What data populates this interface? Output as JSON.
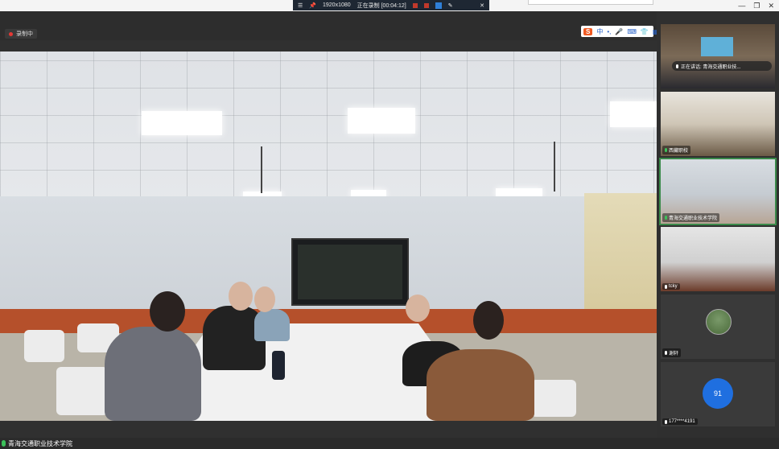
{
  "recorder_toolbar": {
    "resolution": "1920x1080",
    "status": "正在录制 [00:04:12]"
  },
  "stage": {
    "recording_badge": "录制中",
    "main_participant_label": "青海交通职业技术学院"
  },
  "ime": {
    "logo": "S",
    "lang": "中"
  },
  "participants": [
    {
      "name": "",
      "speaking_text": "正在讲话: 青海交通职业技..."
    },
    {
      "name": "西藏职校"
    },
    {
      "name": "青海交通职业技术学院"
    },
    {
      "name": "tcky"
    },
    {
      "name": "谢轩"
    },
    {
      "name": "177****4191",
      "avatar_text": "91"
    }
  ],
  "colors": {
    "accent_blue": "#1f6fe0",
    "mic_green": "#3cc15a",
    "record_red": "#e53935"
  }
}
